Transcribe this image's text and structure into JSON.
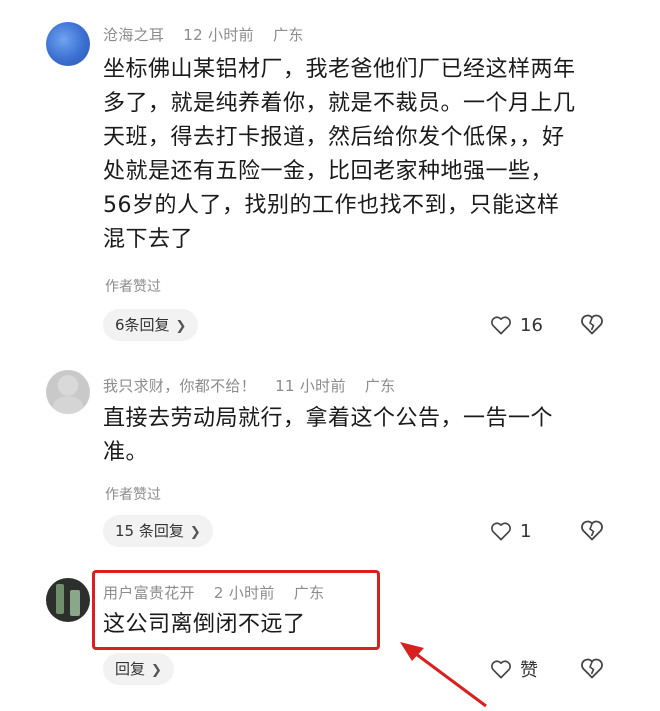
{
  "comments": [
    {
      "username": "沧海之耳",
      "time": "12 小时前",
      "location": "广东",
      "lines": [
        "坐标佛山某铝材厂，我老爸他们厂已经这样两年",
        "多了，就是纯养着你，就是不裁员。一个月上几",
        "天班，得去打卡报道，然后给你发个低保，，好",
        "处就是还有五险一金，比回老家种地强一些，",
        "56岁的人了，找别的工作也找不到，只能这样",
        "混下去了"
      ],
      "author_liked": "作者赞过",
      "replies": "6条回复",
      "likes": "16"
    },
    {
      "username": "我只求财，你都不给！",
      "time": "11 小时前",
      "location": "广东",
      "lines": [
        "直接去劳动局就行，拿着这个公告，一告一个",
        "准。"
      ],
      "author_liked": "作者赞过",
      "replies": "15 条回复",
      "likes": "1"
    },
    {
      "username": "用户富贵花开",
      "time": "2 小时前",
      "location": "广东",
      "lines": [
        "这公司离倒闭不远了"
      ],
      "reply_label": "回复",
      "likes": "赞"
    }
  ],
  "icons": {
    "like": "heart-outline-icon",
    "dislike": "broken-heart-icon",
    "chevron": "chevron-right-icon"
  },
  "colors": {
    "highlight": "#d9201f",
    "meta_text": "#8c8c8c"
  }
}
